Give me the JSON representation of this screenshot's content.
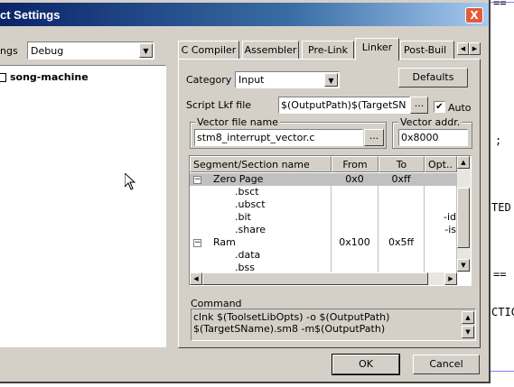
{
  "background_editor": {
    "fragments": [
      "==",
      ";",
      "TED",
      "==",
      "CTIC"
    ]
  },
  "dialog": {
    "title": "ct Settings",
    "close_label": "X",
    "settings_label": "ngs",
    "settings_value": "Debug",
    "tree_root": "song-machine",
    "tabs": [
      "C Compiler",
      "Assembler",
      "Pre-Link",
      "Linker",
      "Post-Buil"
    ],
    "active_tab": "Linker",
    "category_label": "Category",
    "category_value": "Input",
    "defaults_label": "Defaults",
    "script_label": "Script Lkf file",
    "script_value": "$(OutputPath)$(TargetSN",
    "ellipsis": "...",
    "auto_label": "Auto",
    "auto_checked": true,
    "vector_file_label": "Vector file name",
    "vector_file_value": "stm8_interrupt_vector.c",
    "vector_addr_label": "Vector addr.",
    "vector_addr_value": "0x8000",
    "grid": {
      "headers": [
        "Segment/Section name",
        "From",
        "To",
        "Opt.."
      ],
      "rows": [
        {
          "expander": "−",
          "name": "Zero Page",
          "from": "0x0",
          "to": "0xff",
          "opt": "",
          "selected": true,
          "level": 0
        },
        {
          "expander": "",
          "name": ".bsct",
          "from": "",
          "to": "",
          "opt": "",
          "selected": false,
          "level": 1
        },
        {
          "expander": "",
          "name": ".ubsct",
          "from": "",
          "to": "",
          "opt": "",
          "selected": false,
          "level": 1
        },
        {
          "expander": "",
          "name": ".bit",
          "from": "",
          "to": "",
          "opt": "-id",
          "selected": false,
          "level": 1
        },
        {
          "expander": "",
          "name": ".share",
          "from": "",
          "to": "",
          "opt": "-is",
          "selected": false,
          "level": 1
        },
        {
          "expander": "−",
          "name": "Ram",
          "from": "0x100",
          "to": "0x5ff",
          "opt": "",
          "selected": false,
          "level": 0
        },
        {
          "expander": "",
          "name": ".data",
          "from": "",
          "to": "",
          "opt": "",
          "selected": false,
          "level": 1
        },
        {
          "expander": "",
          "name": ".bss",
          "from": "",
          "to": "",
          "opt": "",
          "selected": false,
          "level": 1
        }
      ]
    },
    "command_label": "Command",
    "command_text_line1": "clnk $(ToolsetLibOpts) -o $(OutputPath)",
    "command_text_line2": "$(TargetSName).sm8 -m$(OutputPath)",
    "ok_label": "OK",
    "cancel_label": "Cancel"
  },
  "colors": {
    "dialog_face": "#d4d0c8",
    "title_gradient_start": "#0a246a",
    "close_button": "#e45a3a",
    "selected_row": "#c0c0c0"
  }
}
